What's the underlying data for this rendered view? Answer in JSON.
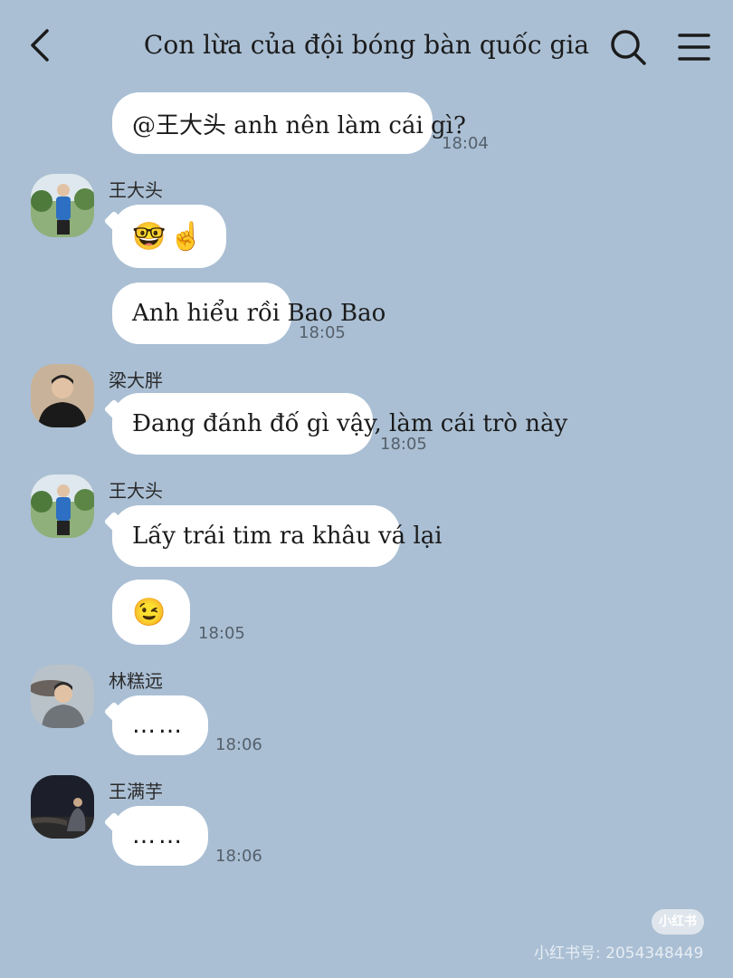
{
  "header": {
    "title": "Con lừa của đội bóng bàn quốc gia",
    "back_icon": "chevron-left-icon",
    "search_icon": "search-icon",
    "menu_icon": "menu-icon"
  },
  "messages": [
    {
      "text": "@王大头 anh nên làm cái gì?",
      "time": "18:04"
    },
    {
      "sender": "王大头",
      "text": "🤓☝️"
    },
    {
      "text": "Anh hiểu rồi Bao Bao",
      "time": "18:05"
    },
    {
      "sender": "梁大胖",
      "text": "Đang đánh đố gì vậy, làm cái trò này",
      "time": "18:05"
    },
    {
      "sender": "王大头",
      "text": "Lấy trái tim ra khâu vá lại"
    },
    {
      "text": "😉",
      "time": "18:05"
    },
    {
      "sender": "林糕远",
      "text": "……",
      "time": "18:06"
    },
    {
      "sender": "王满芋",
      "text": "……",
      "time": "18:06"
    }
  ],
  "watermark": {
    "badge": "小红书",
    "text": "小红书号: 2054348449"
  },
  "colors": {
    "background": "#aabfd4",
    "bubble": "#ffffff"
  }
}
